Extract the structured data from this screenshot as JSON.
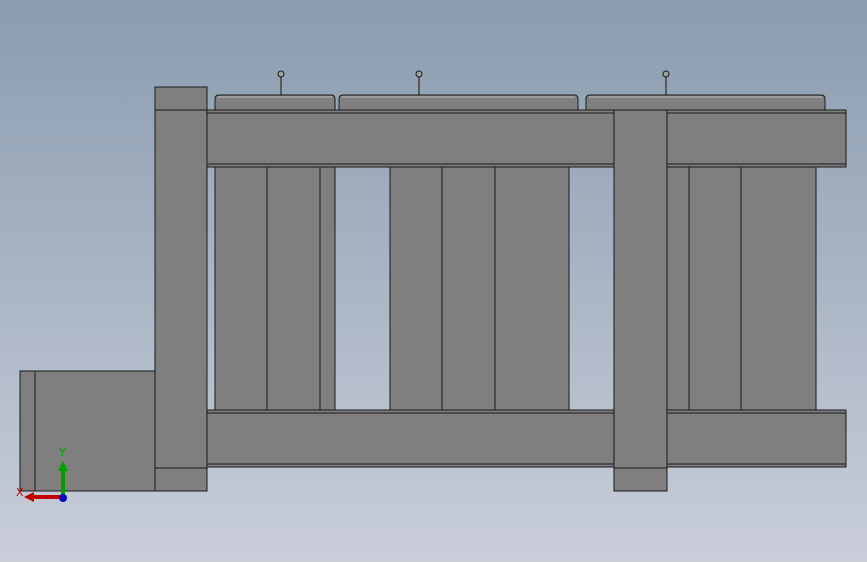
{
  "triad": {
    "x_label": "X",
    "y_label": "Y",
    "x_color": "#c00000",
    "y_color": "#00a000",
    "z_color": "#0000c0"
  },
  "model": {
    "face_color": "#7f7f7f",
    "edge_color": "#1a1a1a",
    "background_top": "#8a9cb0",
    "background_bottom": "#c9ced9"
  }
}
